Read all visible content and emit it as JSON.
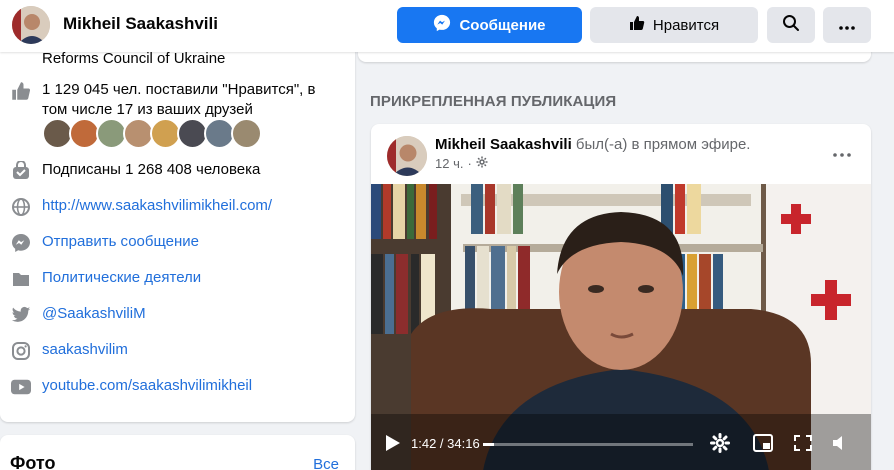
{
  "header": {
    "page_name": "Mikheil Saakashvili",
    "message_button": "Сообщение",
    "like_button": "Нравится"
  },
  "about": {
    "truncated_line": "Reforms Council of Ukraine",
    "likes_text_1": "1 129 045 чел. поставили \"Нравится\", в",
    "likes_text_2": "том числе 17 из ваших друзей",
    "followers": "Подписаны 1 268 408 человека",
    "website": "http://www.saakashvilimikheil.com/",
    "send_message": "Отправить сообщение",
    "category": "Политические деятели",
    "twitter": "@SaakashviliM",
    "instagram": "saakashvilim",
    "youtube": "youtube.com/saakashvilimikheil"
  },
  "photos": {
    "title": "Фото",
    "see_all": "Все"
  },
  "pinned": {
    "section_label": "ПРИКРЕПЛЕННАЯ ПУБЛИКАЦИЯ",
    "author": "Mikheil Saakashvili",
    "action": "был(-а) в прямом эфире.",
    "time": "12 ч.",
    "video": {
      "current_time": "1:42 / 34:16",
      "progress": 0.05
    }
  },
  "colors": {
    "brand_blue": "#1877f2",
    "link_blue": "#216fdb",
    "secondary_text": "#65676b"
  }
}
